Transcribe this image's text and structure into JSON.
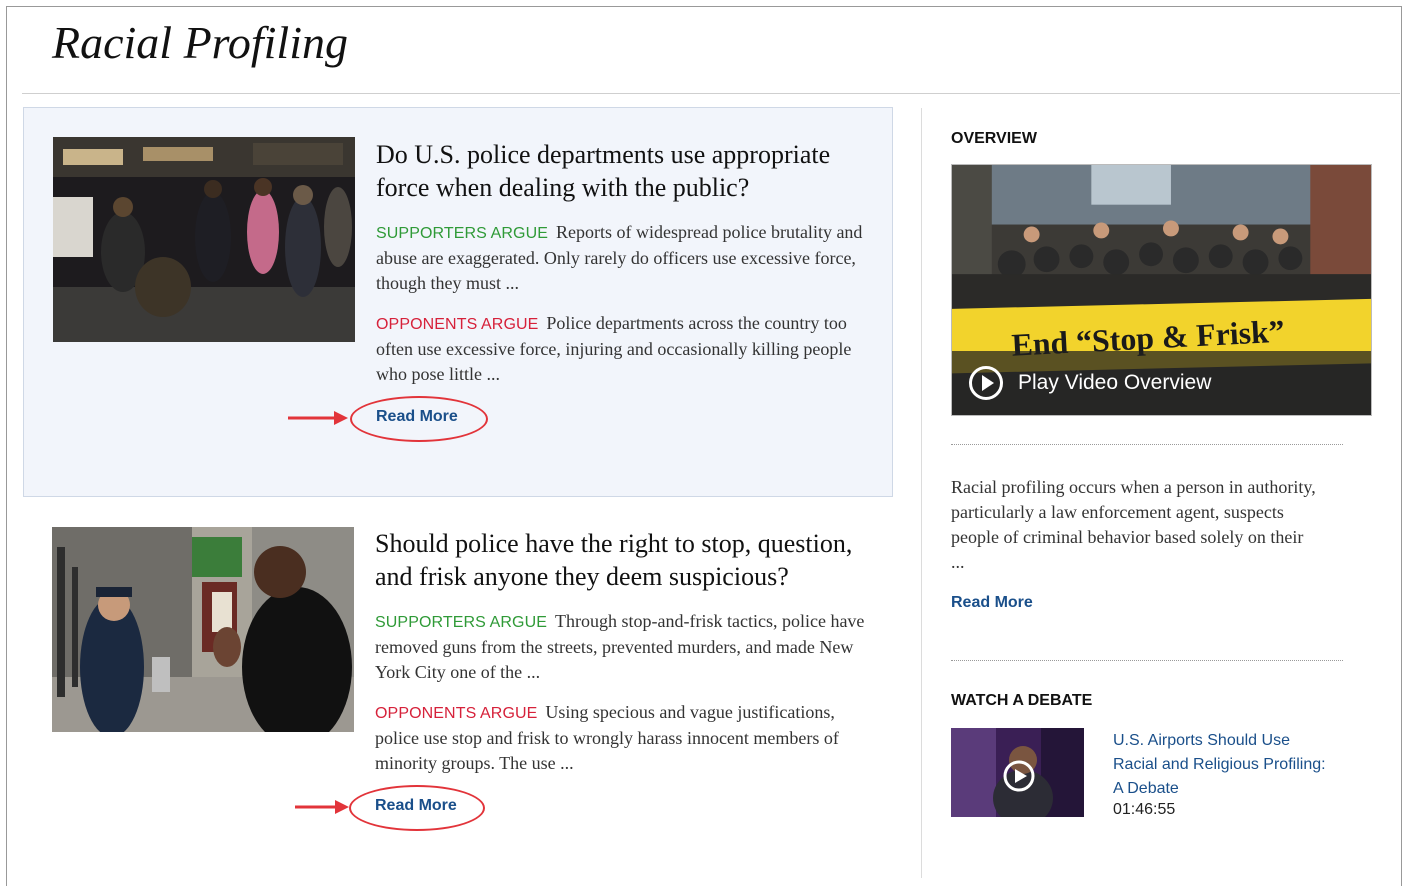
{
  "page": {
    "title": "Racial Profiling"
  },
  "issues": [
    {
      "question": "Do U.S. police departments use appropriate force when dealing with the public?",
      "supporters_label": "SUPPORTERS ARGUE",
      "supporters_text": "Reports of widespread police brutality and abuse are exaggerated. Only rarely do officers use excessive force, though they must ...",
      "opponents_label": "OPPONENTS ARGUE",
      "opponents_text": "Police departments across the country too often use excessive force, injuring and occasionally killing people who pose little ...",
      "read_more": "Read More"
    },
    {
      "question": "Should police have the right to stop, question, and frisk anyone they deem suspicious?",
      "supporters_label": "SUPPORTERS ARGUE",
      "supporters_text": "Through stop-and-frisk tactics, police have removed guns from the streets, prevented murders, and made New York City one of the ...",
      "opponents_label": "OPPONENTS ARGUE",
      "opponents_text": "Using specious and vague justifications, police use stop and frisk to wrongly harass innocent members of minority groups. The use ...",
      "read_more": "Read More"
    }
  ],
  "sidebar": {
    "overview_heading": "OVERVIEW",
    "video_label": "Play Video Overview",
    "banner_text": "End “Stop & Frisk”",
    "overview_text": "Racial profiling occurs when a person in authority, particularly a law enforcement agent, suspects people of criminal behavior based solely on their ...",
    "read_more": "Read More",
    "debate_heading": "WATCH A DEBATE",
    "debate_title": "U.S. Airports Should Use Racial and Religious Profiling: A Debate",
    "debate_duration": "01:46:55"
  },
  "colors": {
    "supporters": "#2f9a37",
    "opponents": "#d6213a",
    "link": "#1a4f8a",
    "highlight": "#e2343a"
  }
}
